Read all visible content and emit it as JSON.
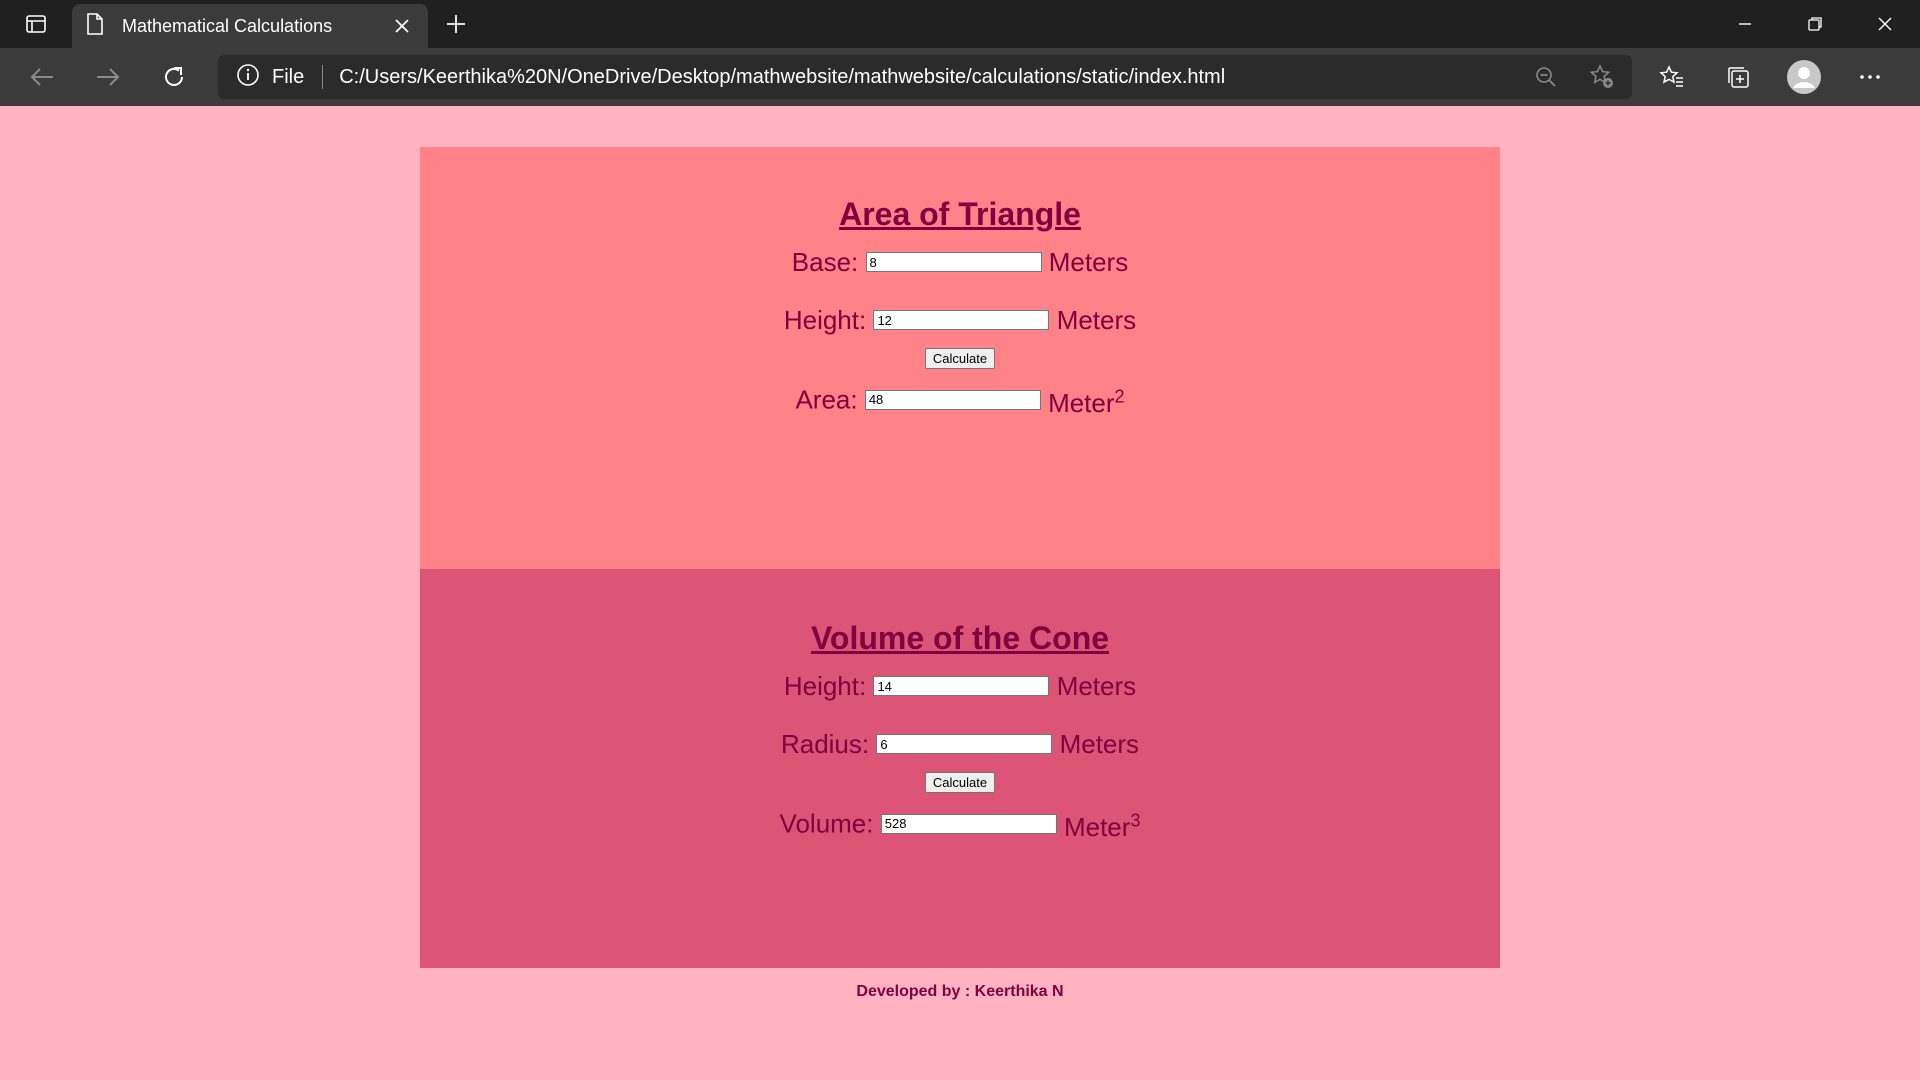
{
  "browser": {
    "tab_title": "Mathematical Calculations",
    "address": {
      "scheme_label": "File",
      "url": "C:/Users/Keerthika%20N/OneDrive/Desktop/mathwebsite/mathwebsite/calculations/static/index.html"
    }
  },
  "triangle": {
    "title": "Area of Triangle",
    "base_label": "Base:",
    "base_value": "8",
    "base_unit": "Meters",
    "height_label": "Height:",
    "height_value": "12",
    "height_unit": "Meters",
    "calculate_label": "Calculate",
    "area_label": "Area:",
    "area_value": "48",
    "area_unit": "Meter",
    "area_unit_exp": "2"
  },
  "cone": {
    "title": "Volume of the Cone",
    "height_label": "Height:",
    "height_value": "14",
    "height_unit": "Meters",
    "radius_label": "Radius:",
    "radius_value": "6",
    "radius_unit": "Meters",
    "calculate_label": "Calculate",
    "volume_label": "Volume:",
    "volume_value": "528",
    "volume_unit": "Meter",
    "volume_unit_exp": "3"
  },
  "footer": {
    "text": "Developed by : Keerthika N"
  },
  "colors": {
    "page_bg": "#ffb3c1",
    "triangle_bg": "#ff8288",
    "cone_bg": "#dc5577",
    "text": "#800040"
  }
}
